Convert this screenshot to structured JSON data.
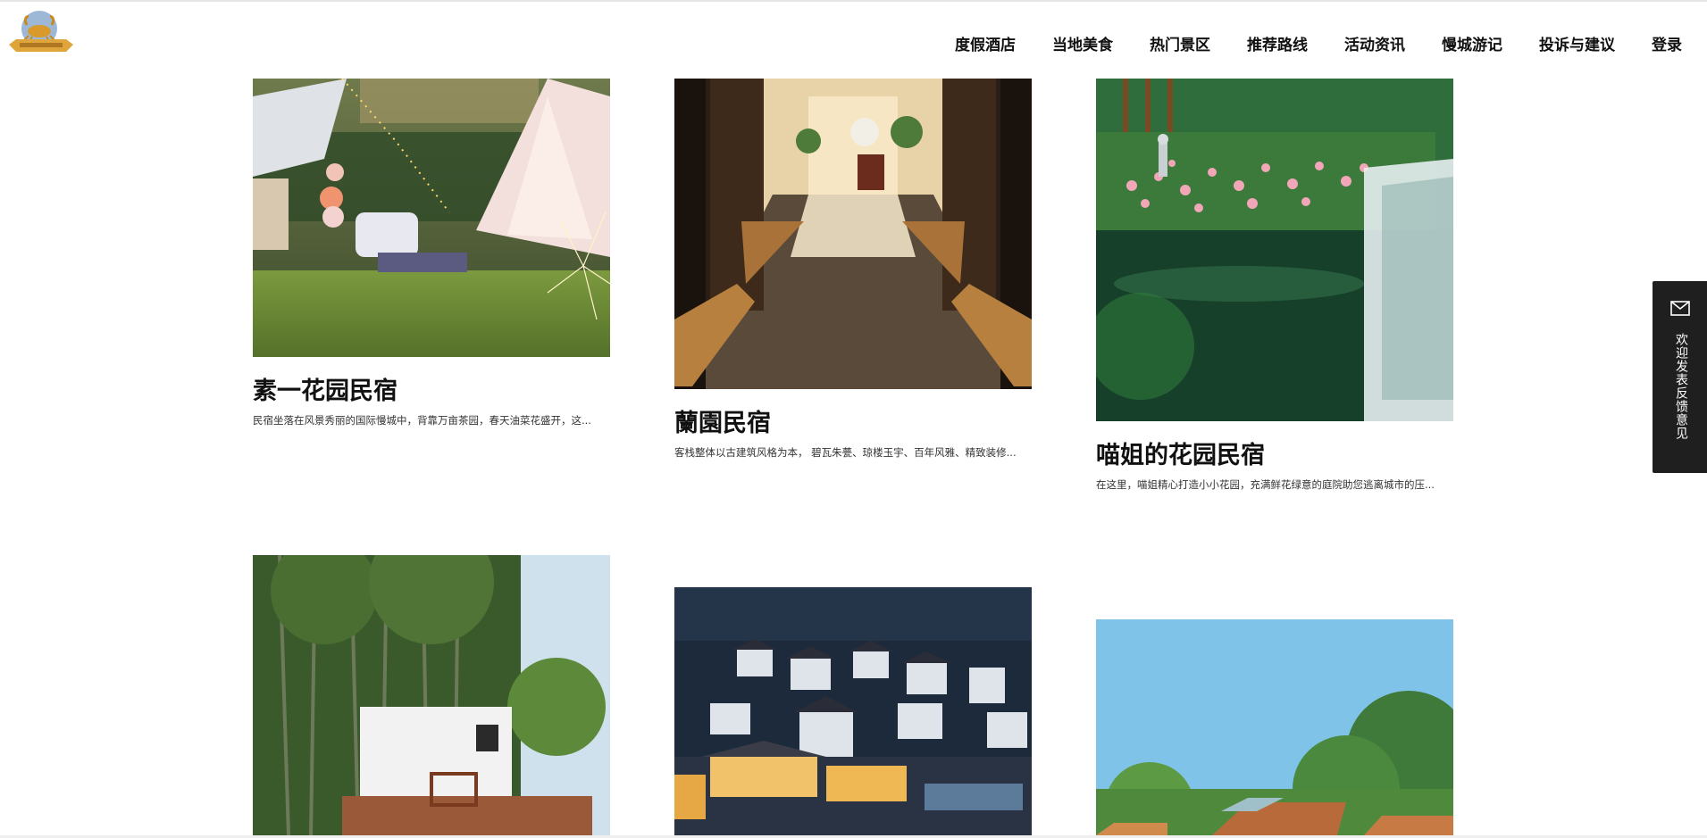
{
  "header": {
    "logo_name": "crab-logo",
    "nav": [
      {
        "label": "度假酒店"
      },
      {
        "label": "当地美食"
      },
      {
        "label": "热门景区"
      },
      {
        "label": "推荐路线"
      },
      {
        "label": "活动资讯"
      },
      {
        "label": "慢城游记"
      },
      {
        "label": "投诉与建议"
      },
      {
        "label": "登录"
      }
    ]
  },
  "cards": [
    {
      "title": "素一花园民宿",
      "desc": "民宿坐落在风景秀丽的国际慢城中，背靠万亩茶园，春天油菜花盛开，这..."
    },
    {
      "title": "蘭園民宿",
      "desc": "客栈整体以古建筑风格为本， 碧瓦朱甍、琼楼玉宇、百年风雅、精致装修..."
    },
    {
      "title": "喵姐的花园民宿",
      "desc": "在这里，喵姐精心打造小小花园，充满鲜花绿意的庭院助您逃离城市的压..."
    },
    {
      "title": "",
      "desc": ""
    },
    {
      "title": "",
      "desc": ""
    },
    {
      "title": "",
      "desc": ""
    }
  ],
  "feedback": {
    "icon": "mail-icon",
    "label": "欢迎发表反馈意见"
  },
  "colors": {
    "text": "#111111",
    "feedback_bg": "#1f1f1f"
  }
}
